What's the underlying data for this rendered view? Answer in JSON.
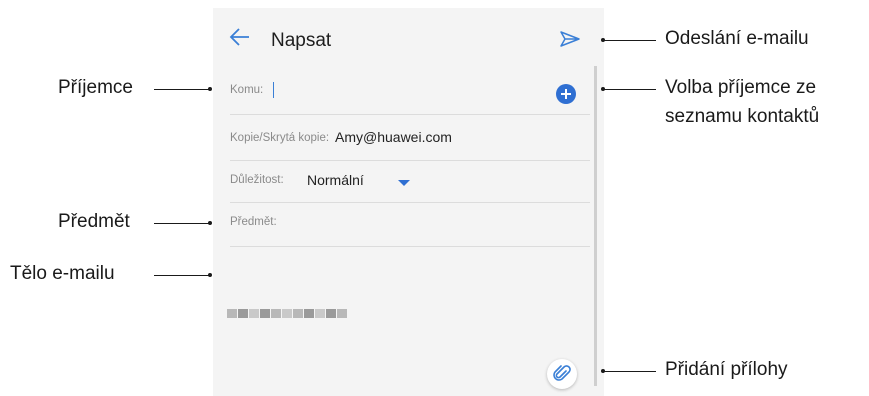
{
  "appbar": {
    "title": "Napsat",
    "back_icon": "arrow-left-icon",
    "send_icon": "send-icon"
  },
  "compose": {
    "to_label": "Komu:",
    "cc_label": "Kopie/Skrytá kopie:",
    "cc_value": "Amy@huawei.com",
    "priority_label": "Důležitost:",
    "priority_value": "Normální",
    "subject_label": "Předmět:",
    "add_recipient_icon": "plus-circle-icon",
    "attach_icon": "paperclip-icon"
  },
  "callouts": {
    "recipient": "Příjemce",
    "subject": "Předmět",
    "body": "Tělo e-mailu",
    "send": "Odeslání e-mailu",
    "contacts_line1": "Volba příjemce ze",
    "contacts_line2": "seznamu kontaktů",
    "attachment": "Přidání přílohy"
  },
  "colors": {
    "accent": "#2f6fd2",
    "background": "#f4f4f4"
  }
}
